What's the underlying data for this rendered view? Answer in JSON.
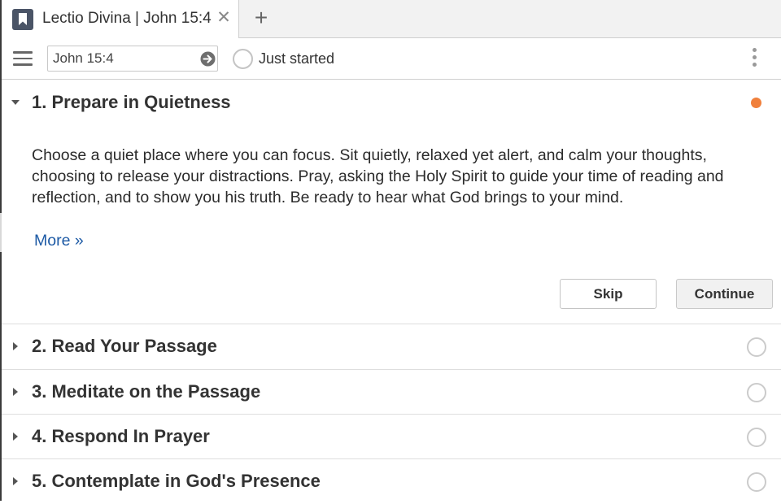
{
  "tab": {
    "title": "Lectio Divina | John 15:4",
    "icon": "bookmark-icon",
    "close_glyph": "✕",
    "new_tab_glyph": "+"
  },
  "toolbar": {
    "reference_value": "John 15:4",
    "status_label": "Just started"
  },
  "steps": [
    {
      "title": "1. Prepare in Quietness",
      "expanded": true,
      "status": "in-progress",
      "body": "Choose a quiet place where you can focus.  Sit quietly, relaxed yet alert, and calm your thoughts, choosing to release your distractions. Pray, asking the Holy Spirit to guide your time of reading and reflection, and to show you his truth. Be ready to hear what God brings to your mind.",
      "more_label": "More »",
      "skip_label": "Skip",
      "continue_label": "Continue"
    },
    {
      "title": "2. Read Your Passage",
      "expanded": false,
      "status": "not-started"
    },
    {
      "title": "3. Meditate on the Passage",
      "expanded": false,
      "status": "not-started"
    },
    {
      "title": "4. Respond In Prayer",
      "expanded": false,
      "status": "not-started"
    },
    {
      "title": "5. Contemplate in God's Presence",
      "expanded": false,
      "status": "not-started"
    }
  ],
  "colors": {
    "accent_dot": "#f0803c",
    "link": "#1d5aa5",
    "tab_icon": "#4a5466"
  }
}
